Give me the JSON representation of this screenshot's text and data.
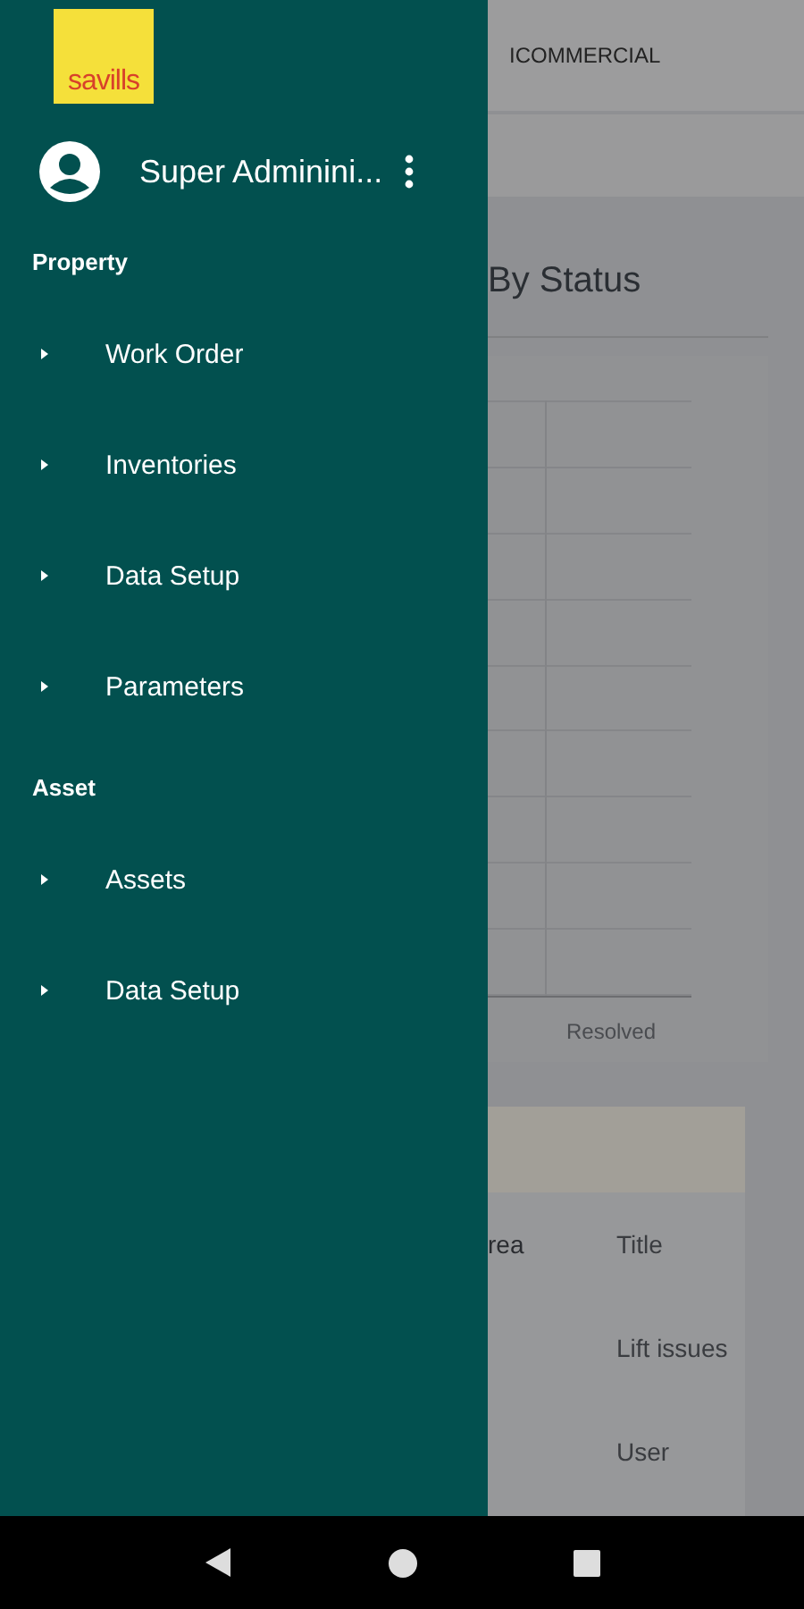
{
  "drawer": {
    "logo": "savills",
    "user": {
      "name": "Super Adminini..."
    },
    "sections": [
      {
        "title": "Property",
        "items": [
          {
            "label": "Work Order"
          },
          {
            "label": "Inventories"
          },
          {
            "label": "Data Setup"
          },
          {
            "label": "Parameters"
          }
        ]
      },
      {
        "title": "Asset",
        "items": [
          {
            "label": "Assets"
          },
          {
            "label": "Data Setup"
          }
        ]
      }
    ]
  },
  "page": {
    "header": "ICOMMERCIAL",
    "card_title": "By Status",
    "chart_label": "Resolved",
    "table": {
      "columns": [
        "rea",
        "Title"
      ],
      "rows": [
        {
          "title": "Lift issues"
        },
        {
          "title": "User"
        }
      ]
    }
  }
}
